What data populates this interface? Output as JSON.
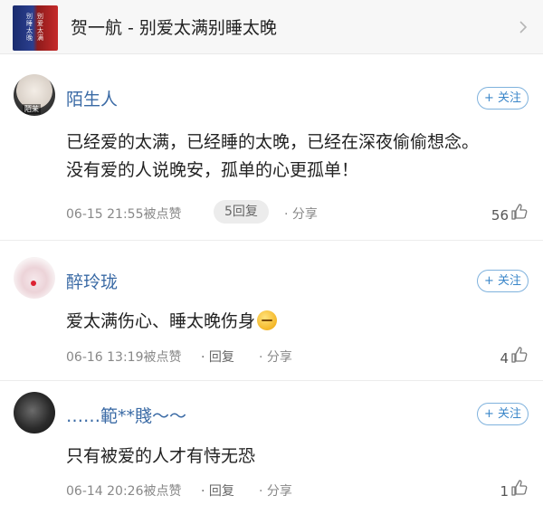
{
  "song": {
    "title": "贺一航 - 别爱太满别睡太晚",
    "cover_text_left": "别睡太晚",
    "cover_text_right": "别爱太满"
  },
  "follow_label": "+ 关注",
  "comments": [
    {
      "username": "陌生人",
      "avatar_tag": "陌苿",
      "lines": [
        "已经爱的太满，已经睡的太晚，已经在深夜偷偷想念。",
        "没有爱的人说晚安，孤单的心更孤单！"
      ],
      "time": "06-15 21:55被点赞",
      "reply_label": "5回复",
      "share_label": "· 分享",
      "likes": "56"
    },
    {
      "username": "醉玲珑",
      "lines": [
        "爱太满伤心、睡太晚伤身"
      ],
      "time": "06-16 13:19被点赞",
      "reply_label": "· 回复",
      "share_label": "· 分享",
      "likes": "4"
    },
    {
      "username": "……範**賤～～",
      "lines": [
        "只有被爱的人才有恃无恐"
      ],
      "time": "06-14 20:26被点赞",
      "reply_label": "· 回复",
      "share_label": "· 分享",
      "likes": "1"
    }
  ],
  "colors": {
    "username": "#3a6aa5",
    "follow_border": "#7fb2dd",
    "follow_text": "#3a86c9",
    "meta": "#888888"
  },
  "icons": [
    "chevron-right-icon",
    "thumbs-up-icon",
    "sleepy-face-emoji"
  ]
}
